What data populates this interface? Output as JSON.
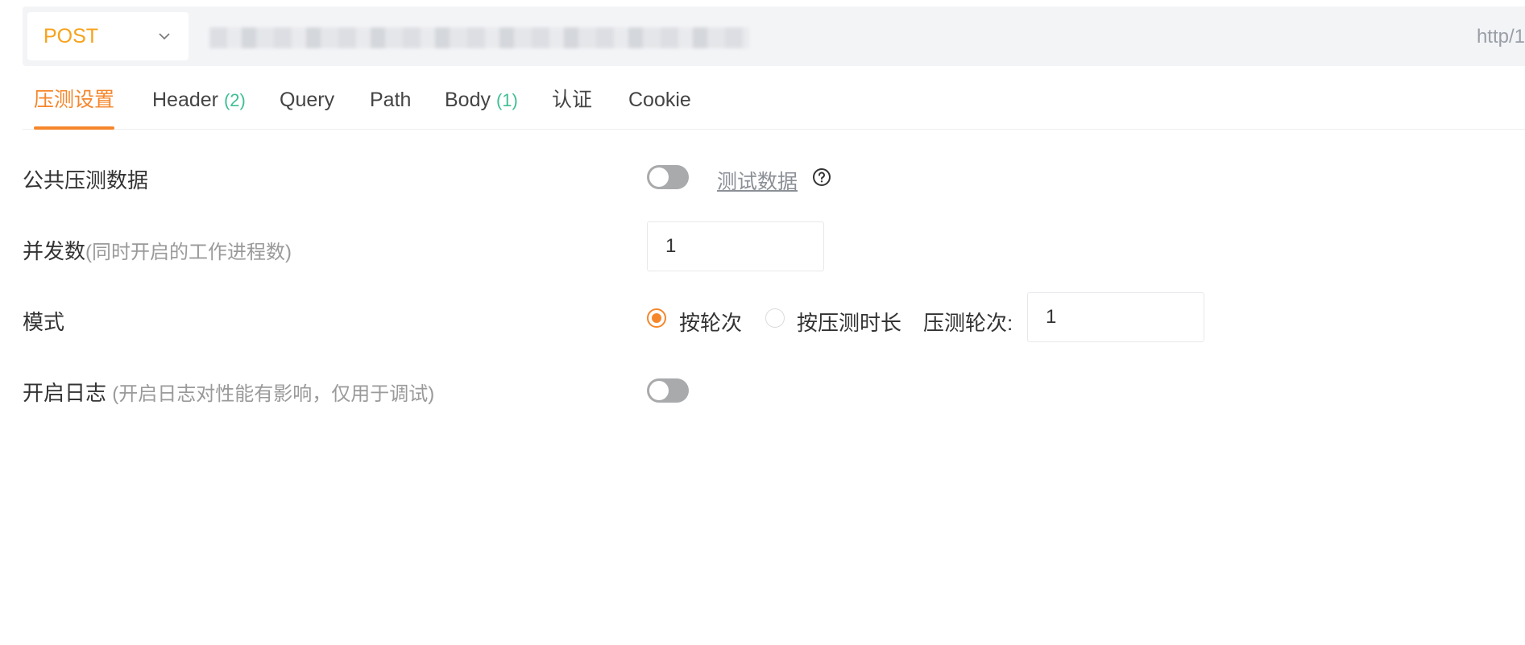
{
  "request": {
    "method": "POST",
    "url_visible_suffix": "http/1"
  },
  "tabs": [
    {
      "label": "压测设置",
      "count": ""
    },
    {
      "label": "Header",
      "count": "(2)"
    },
    {
      "label": "Query",
      "count": ""
    },
    {
      "label": "Path",
      "count": ""
    },
    {
      "label": "Body",
      "count": "(1)"
    },
    {
      "label": "认证",
      "count": ""
    },
    {
      "label": "Cookie",
      "count": ""
    }
  ],
  "settings": {
    "public_data": {
      "label": "公共压测数据",
      "enabled": false,
      "link": "测试数据"
    },
    "concurrency": {
      "label": "并发数",
      "hint": "(同时开启的工作进程数)",
      "value": "1"
    },
    "mode": {
      "label": "模式",
      "options": [
        {
          "label": "按轮次",
          "selected": true
        },
        {
          "label": "按压测时长",
          "selected": false
        }
      ],
      "rounds_label": "压测轮次:",
      "rounds_value": "1"
    },
    "logging": {
      "label": "开启日志",
      "hint": "(开启日志对性能有影响，仅用于调试)",
      "enabled": false
    }
  },
  "colors": {
    "accent": "#f5862a",
    "method": "#f7a21b",
    "count": "#3fbf93"
  }
}
